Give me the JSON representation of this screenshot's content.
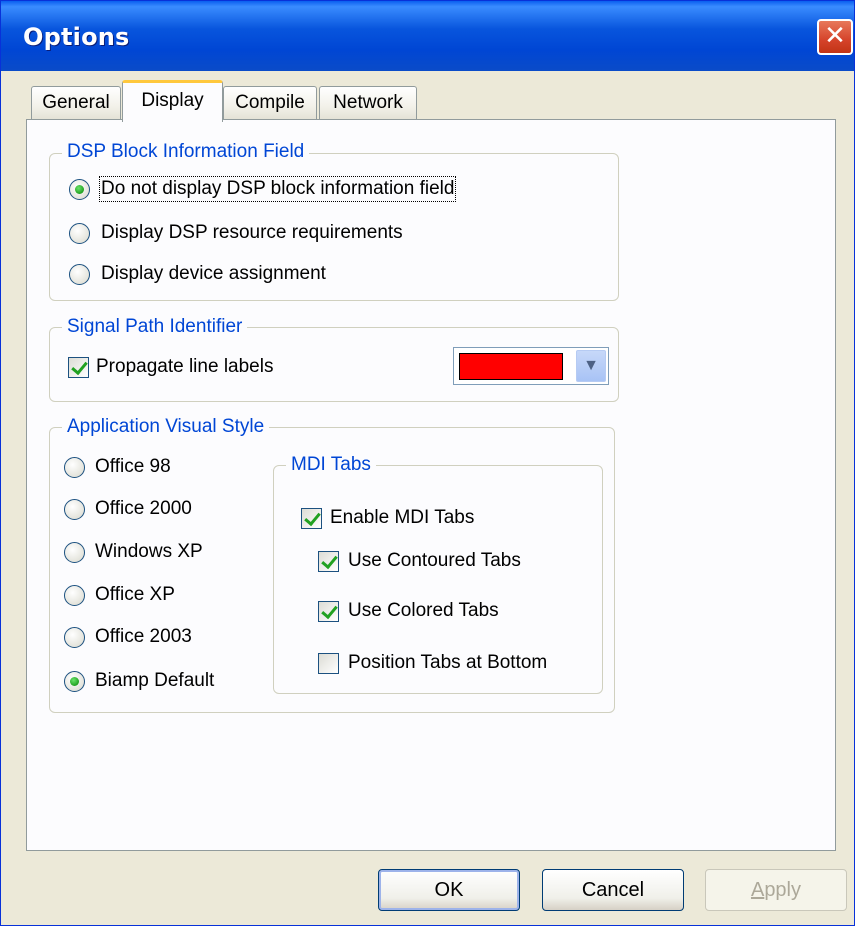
{
  "window": {
    "title": "Options",
    "close_icon": "close-icon",
    "close_glyph": "✕"
  },
  "tabs": [
    {
      "label": "General",
      "active": false
    },
    {
      "label": "Display",
      "active": true
    },
    {
      "label": "Compile",
      "active": false
    },
    {
      "label": "Network",
      "active": false
    }
  ],
  "dsp_block": {
    "legend": "DSP Block Information Field",
    "options": [
      {
        "label": "Do not display DSP block information field",
        "selected": true
      },
      {
        "label": "Display DSP resource requirements",
        "selected": false
      },
      {
        "label": "Display device assignment",
        "selected": false
      }
    ]
  },
  "signal_path": {
    "legend": "Signal Path Identifier",
    "propagate_label": "Propagate line labels",
    "propagate_checked": true,
    "color_value": "#ff0000",
    "dropdown_icon": "chevron-down-icon",
    "dropdown_glyph": "▼"
  },
  "visual_style": {
    "legend": "Application Visual Style",
    "options": [
      {
        "label": "Office 98",
        "selected": false
      },
      {
        "label": "Office 2000",
        "selected": false
      },
      {
        "label": "Windows XP",
        "selected": false
      },
      {
        "label": "Office XP",
        "selected": false
      },
      {
        "label": "Office 2003",
        "selected": false
      },
      {
        "label": "Biamp Default",
        "selected": true
      }
    ]
  },
  "mdi_tabs": {
    "legend": "MDI Tabs",
    "enable": {
      "label": "Enable MDI Tabs",
      "checked": true
    },
    "contoured": {
      "label": "Use Contoured Tabs",
      "checked": true
    },
    "colored": {
      "label": "Use Colored Tabs",
      "checked": true
    },
    "bottom": {
      "label": "Position Tabs at Bottom",
      "checked": false
    }
  },
  "buttons": {
    "ok": "OK",
    "cancel": "Cancel",
    "apply_mnemonic": "A",
    "apply_rest": "pply"
  },
  "colors": {
    "accent": "#0046d5",
    "title_bar": "#0855dd",
    "panel": "#fcfcfe",
    "window_bg": "#ece9d8"
  }
}
